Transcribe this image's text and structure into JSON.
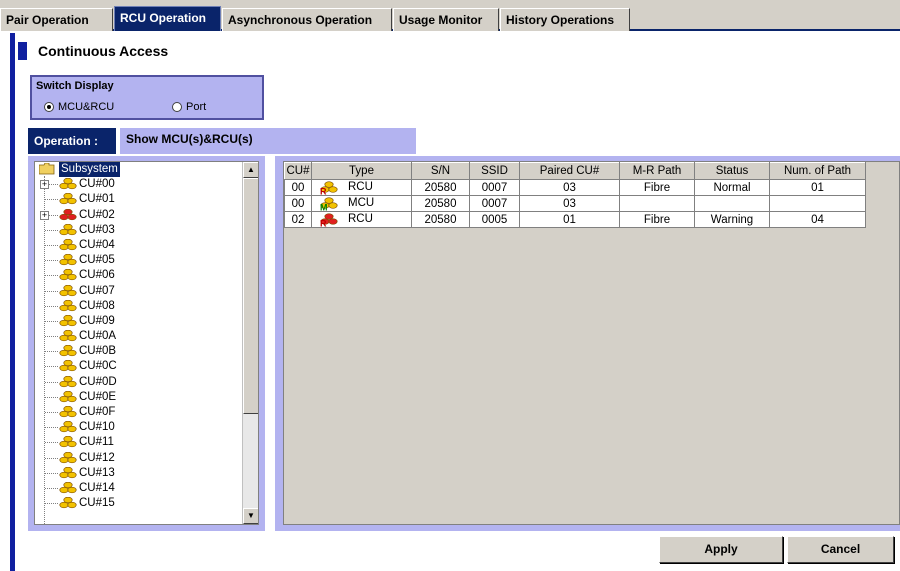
{
  "tabs": [
    {
      "label": "Pair Operation",
      "active": false
    },
    {
      "label": "RCU Operation",
      "active": true
    },
    {
      "label": "Asynchronous Operation",
      "active": false
    },
    {
      "label": "Usage Monitor",
      "active": false
    },
    {
      "label": "History Operations",
      "active": false
    }
  ],
  "page": {
    "title": "Continuous Access"
  },
  "switch_display": {
    "legend": "Switch Display",
    "options": [
      {
        "label": "MCU&RCU",
        "selected": true
      },
      {
        "label": "Port",
        "selected": false
      }
    ]
  },
  "operation": {
    "label": "Operation :",
    "value": "Show MCU(s)&RCU(s)"
  },
  "tree": {
    "root": "Subsystem",
    "items": [
      {
        "label": "CU#00",
        "expandable": true,
        "type": "normal"
      },
      {
        "label": "CU#01",
        "expandable": false,
        "type": "normal"
      },
      {
        "label": "CU#02",
        "expandable": true,
        "type": "warning"
      },
      {
        "label": "CU#03",
        "expandable": false,
        "type": "normal"
      },
      {
        "label": "CU#04",
        "expandable": false,
        "type": "normal"
      },
      {
        "label": "CU#05",
        "expandable": false,
        "type": "normal"
      },
      {
        "label": "CU#06",
        "expandable": false,
        "type": "normal"
      },
      {
        "label": "CU#07",
        "expandable": false,
        "type": "normal"
      },
      {
        "label": "CU#08",
        "expandable": false,
        "type": "normal"
      },
      {
        "label": "CU#09",
        "expandable": false,
        "type": "normal"
      },
      {
        "label": "CU#0A",
        "expandable": false,
        "type": "normal"
      },
      {
        "label": "CU#0B",
        "expandable": false,
        "type": "normal"
      },
      {
        "label": "CU#0C",
        "expandable": false,
        "type": "normal"
      },
      {
        "label": "CU#0D",
        "expandable": false,
        "type": "normal"
      },
      {
        "label": "CU#0E",
        "expandable": false,
        "type": "normal"
      },
      {
        "label": "CU#0F",
        "expandable": false,
        "type": "normal"
      },
      {
        "label": "CU#10",
        "expandable": false,
        "type": "normal"
      },
      {
        "label": "CU#11",
        "expandable": false,
        "type": "normal"
      },
      {
        "label": "CU#12",
        "expandable": false,
        "type": "normal"
      },
      {
        "label": "CU#13",
        "expandable": false,
        "type": "normal"
      },
      {
        "label": "CU#14",
        "expandable": false,
        "type": "normal"
      },
      {
        "label": "CU#15",
        "expandable": false,
        "type": "normal"
      }
    ]
  },
  "table": {
    "columns": [
      "CU#",
      "Type",
      "S/N",
      "SSID",
      "Paired CU#",
      "M-R Path",
      "Status",
      "Num. of Path"
    ],
    "rows": [
      {
        "cu": "00",
        "type": "RCU",
        "badge": "R",
        "icon": "rcu-icon",
        "sn": "20580",
        "ssid": "0007",
        "paired": "03",
        "path": "Fibre",
        "status": "Normal",
        "num": "01"
      },
      {
        "cu": "00",
        "type": "MCU",
        "badge": "M",
        "icon": "mcu-icon",
        "sn": "20580",
        "ssid": "0007",
        "paired": "03",
        "path": "",
        "status": "",
        "num": ""
      },
      {
        "cu": "02",
        "type": "RCU",
        "badge": "R",
        "icon": "rcu-warning-icon",
        "sn": "20580",
        "ssid": "0005",
        "paired": "01",
        "path": "Fibre",
        "status": "Warning",
        "num": "04"
      }
    ]
  },
  "buttons": {
    "apply": "Apply",
    "cancel": "Cancel"
  },
  "colors": {
    "accent": "#0a246a",
    "panel": "#b3b3f0",
    "face": "#d4d0c8",
    "warning": "#e02020",
    "disk": "#f2c200"
  }
}
